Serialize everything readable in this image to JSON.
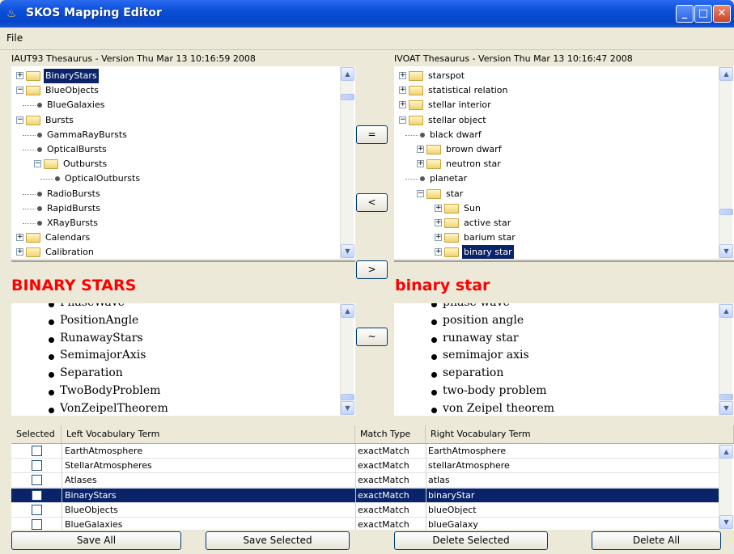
{
  "window": {
    "title": "SKOS Mapping Editor",
    "min": "_",
    "max": "□",
    "close": "✕"
  },
  "menu": {
    "file": "File"
  },
  "left_tree": {
    "header": "IAUT93 Thesaurus - Version Thu Mar 13 10:16:59 2008",
    "rows": [
      {
        "label": "BinaryStars",
        "type": "folder",
        "level": 0,
        "expander": "+",
        "selected": true
      },
      {
        "label": "BlueObjects",
        "type": "folder",
        "level": 0,
        "expander": "-"
      },
      {
        "label": "BlueGalaxies",
        "type": "leaf",
        "level": 1
      },
      {
        "label": "Bursts",
        "type": "folder",
        "level": 0,
        "expander": "-"
      },
      {
        "label": "GammaRayBursts",
        "type": "leaf",
        "level": 1
      },
      {
        "label": "OpticalBursts",
        "type": "leaf",
        "level": 1
      },
      {
        "label": "Outbursts",
        "type": "folder",
        "level": 1,
        "expander": "-"
      },
      {
        "label": "OpticalOutbursts",
        "type": "leaf",
        "level": 2
      },
      {
        "label": "RadioBursts",
        "type": "leaf",
        "level": 1
      },
      {
        "label": "RapidBursts",
        "type": "leaf",
        "level": 1
      },
      {
        "label": "XRayBursts",
        "type": "leaf",
        "level": 1
      },
      {
        "label": "Calendars",
        "type": "folder",
        "level": 0,
        "expander": "+"
      },
      {
        "label": "Calibration",
        "type": "folder",
        "level": 0,
        "expander": "+"
      }
    ]
  },
  "right_tree": {
    "header": "IVOAT Thesaurus - Version Thu Mar 13 10:16:47 2008",
    "rows": [
      {
        "label": "starspot",
        "type": "folder",
        "level": 0,
        "expander": "+"
      },
      {
        "label": "statistical relation",
        "type": "folder",
        "level": 0,
        "expander": "+"
      },
      {
        "label": "stellar interior",
        "type": "folder",
        "level": 0,
        "expander": "+"
      },
      {
        "label": "stellar object",
        "type": "folder",
        "level": 0,
        "expander": "-"
      },
      {
        "label": "black dwarf",
        "type": "leaf",
        "level": 1
      },
      {
        "label": "brown dwarf",
        "type": "folder",
        "level": 1,
        "expander": "+"
      },
      {
        "label": "neutron star",
        "type": "folder",
        "level": 1,
        "expander": "+"
      },
      {
        "label": "planetar",
        "type": "leaf",
        "level": 1
      },
      {
        "label": "star",
        "type": "folder",
        "level": 1,
        "expander": "-"
      },
      {
        "label": "Sun",
        "type": "folder",
        "level": 2,
        "expander": "+"
      },
      {
        "label": "active star",
        "type": "folder",
        "level": 2,
        "expander": "+"
      },
      {
        "label": "barium star",
        "type": "folder",
        "level": 2,
        "expander": "+"
      },
      {
        "label": "binary star",
        "type": "folder",
        "level": 2,
        "expander": "+",
        "selected": true
      }
    ]
  },
  "mid_buttons": {
    "equal": "=",
    "less": "<",
    "greater": ">",
    "tilde": "~"
  },
  "left_detail": {
    "term": "BINARY STARS",
    "items": [
      "PhaseWave",
      "PositionAngle",
      "RunawayStars",
      "SemimajorAxis",
      "Separation",
      "TwoBodyProblem",
      "VonZeipelTheorem"
    ]
  },
  "right_detail": {
    "term": "binary star",
    "items": [
      "phase wave",
      "position angle",
      "runaway star",
      "semimajor axis",
      "separation",
      "two-body problem",
      "von Zeipel theorem"
    ]
  },
  "table": {
    "headers": [
      "Selected",
      "Left Vocabulary Term",
      "Match Type",
      "Right Vocabulary Term"
    ],
    "rows": [
      {
        "left": "EarthAtmosphere",
        "match": "exactMatch",
        "right": "EarthAtmosphere",
        "selected": false
      },
      {
        "left": "StellarAtmospheres",
        "match": "exactMatch",
        "right": "stellarAtmosphere",
        "selected": false
      },
      {
        "left": "Atlases",
        "match": "exactMatch",
        "right": "atlas",
        "selected": false
      },
      {
        "left": "BinaryStars",
        "match": "exactMatch",
        "right": "binaryStar",
        "selected": false,
        "highlight": true
      },
      {
        "left": "BlueObjects",
        "match": "exactMatch",
        "right": "blueObject",
        "selected": false
      },
      {
        "left": "BlueGalaxies",
        "match": "exactMatch",
        "right": "blueGalaxy",
        "selected": false
      }
    ]
  },
  "buttons": {
    "save_all": "Save All",
    "save_selected": "Save Selected",
    "delete_selected": "Delete Selected",
    "delete_all": "Delete All"
  },
  "colors": {
    "title_bar": "#0a4fd6",
    "selection": "#0a246a",
    "term_red": "#ff0000",
    "window_bg": "#ece9d8"
  }
}
